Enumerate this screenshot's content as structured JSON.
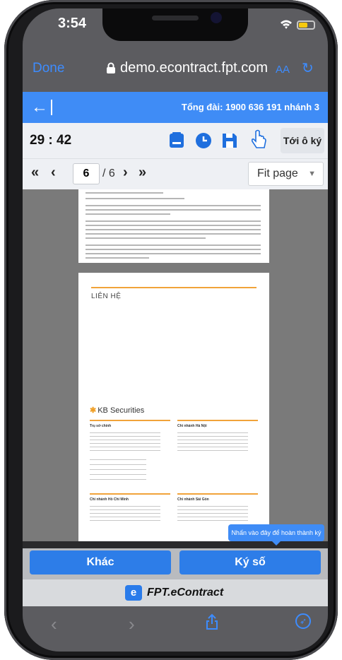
{
  "status_bar": {
    "time": "3:54"
  },
  "browser": {
    "done_label": "Done",
    "url": "demo.econtract.fpt.com",
    "text_size_label": "AA"
  },
  "app_header": {
    "hotline": "Tổng đài: 1900 636 191 nhánh 3"
  },
  "toolbar": {
    "timer": "29 : 42",
    "goto_sign_label": "Tới ô ký"
  },
  "pager": {
    "current_page": "6",
    "total_pages": "/ 6",
    "zoom_option": "Fit page"
  },
  "document": {
    "contact_heading": "LIÊN HỆ",
    "company_name": "KB Securities",
    "offices": [
      {
        "title": "Trụ sở chính"
      },
      {
        "title": "Chi nhánh Hà Nội"
      },
      {
        "title": "Chi nhánh Hồ Chí Minh"
      },
      {
        "title": "Chi nhánh Sài Gòn"
      }
    ]
  },
  "tooltip": {
    "text": "Nhấn vào đây để hoàn thành ký"
  },
  "actions": {
    "other_label": "Khác",
    "sign_label": "Ký số"
  },
  "brand": {
    "logo_letter": "e",
    "name": "FPT.eContract"
  },
  "colors": {
    "primary": "#3f8cf6",
    "action": "#2d7de8",
    "accent_orange": "#f1a33a"
  }
}
